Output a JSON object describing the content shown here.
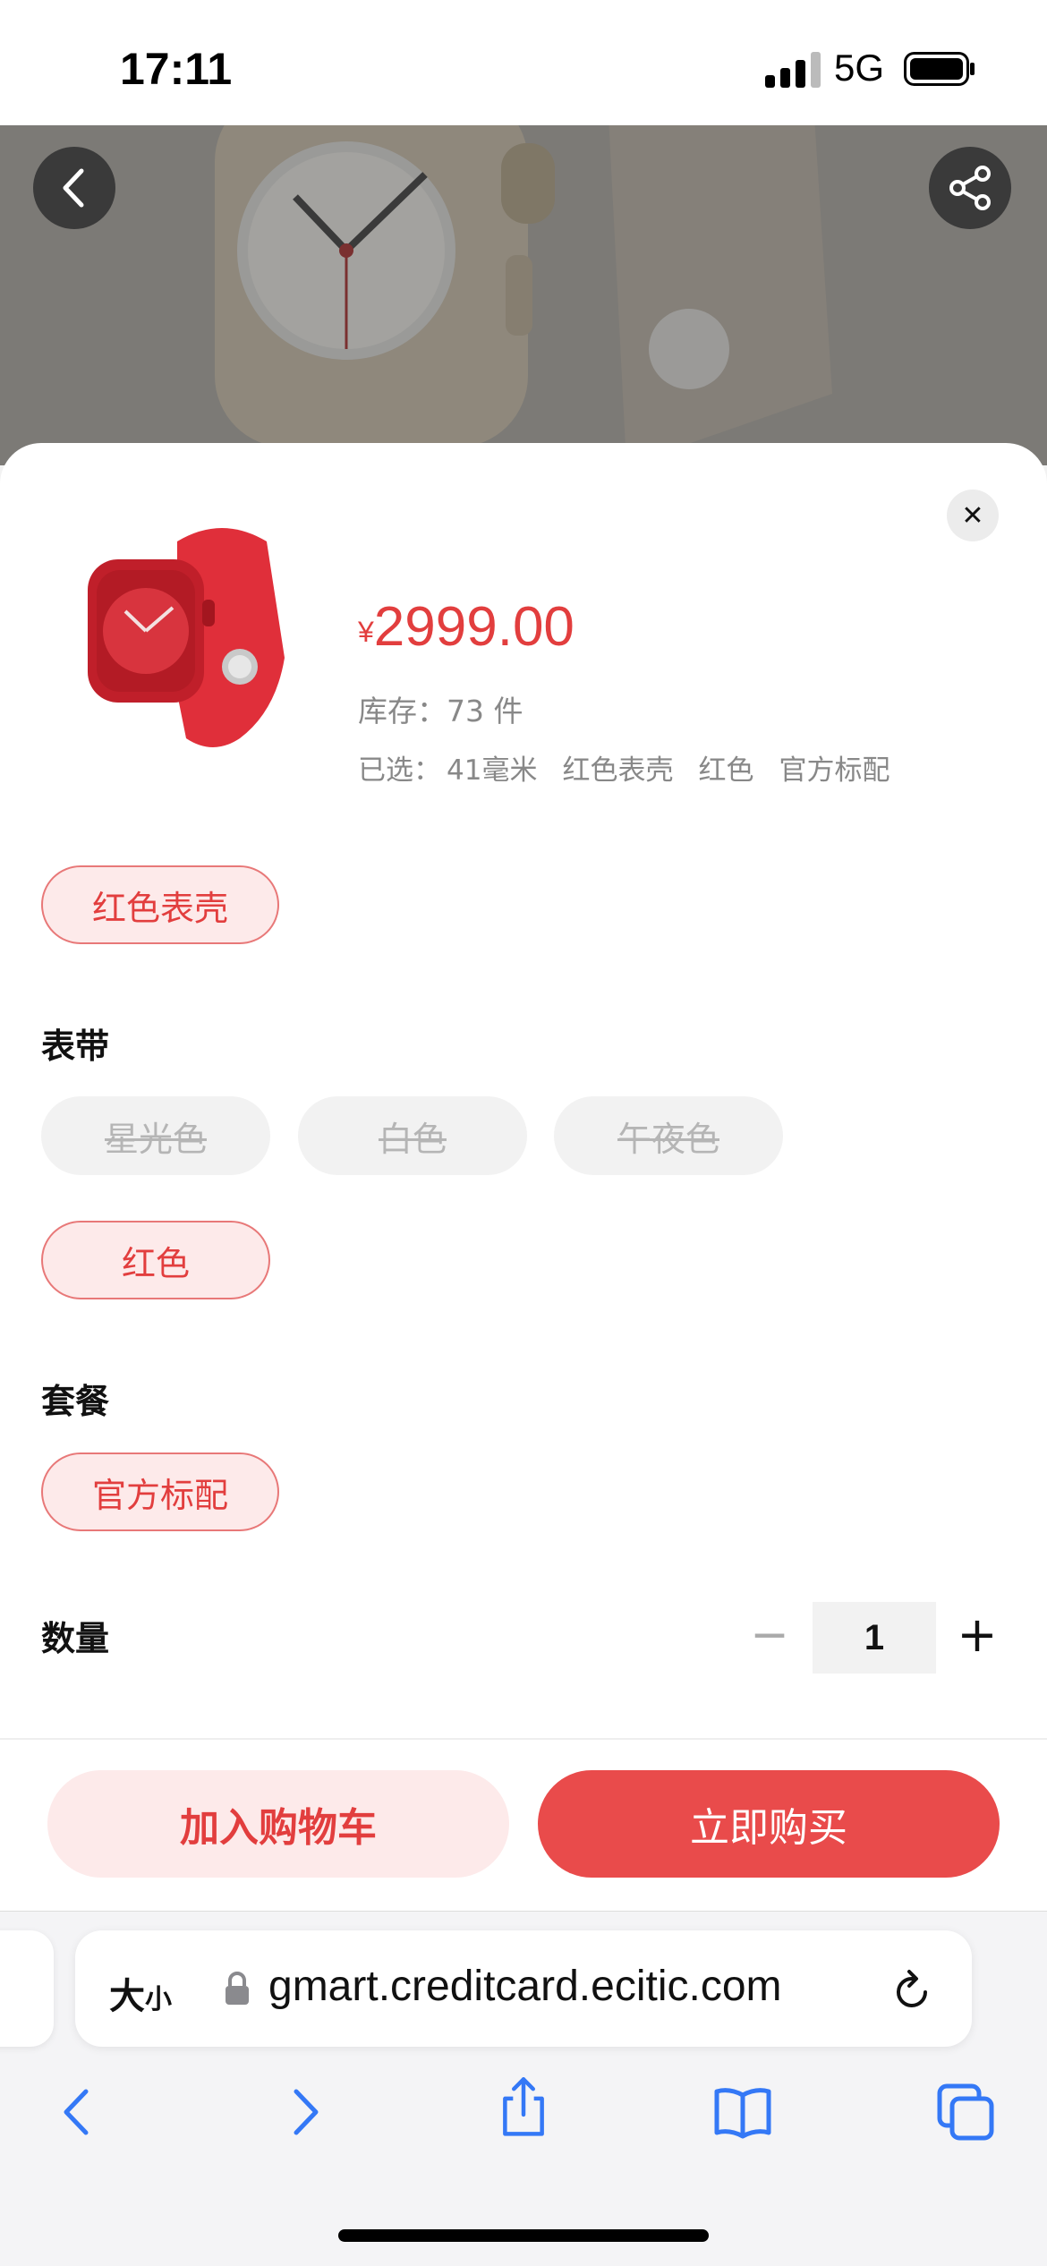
{
  "status_bar": {
    "time": "17:11",
    "network": "5G"
  },
  "product": {
    "currency": "¥",
    "price": "2999.00",
    "stock_label": "库存：73 件",
    "selected_label": "已选：",
    "selected_options": [
      "41毫米",
      "红色表壳",
      "红色",
      "官方标配"
    ]
  },
  "options": {
    "case": {
      "chips": [
        {
          "label": "红色表壳",
          "state": "active"
        }
      ]
    },
    "band": {
      "title": "表带",
      "chips": [
        {
          "label": "星光色",
          "state": "disabled"
        },
        {
          "label": "白色",
          "state": "disabled"
        },
        {
          "label": "午夜色",
          "state": "disabled"
        },
        {
          "label": "红色",
          "state": "active"
        }
      ]
    },
    "package": {
      "title": "套餐",
      "chips": [
        {
          "label": "官方标配",
          "state": "active"
        }
      ]
    }
  },
  "quantity": {
    "title": "数量",
    "value": "1",
    "minus": "−",
    "plus": "+"
  },
  "actions": {
    "add_to_cart": "加入购物车",
    "buy_now": "立即购买"
  },
  "close_glyph": "✕",
  "browser": {
    "text_size_label": "大",
    "text_size_small": "小",
    "url": "gmart.creditcard.ecitic.com"
  },
  "colors": {
    "accent": "#e23e3e",
    "buy_button": "#e94b4b",
    "chip_bg": "#fdeaea",
    "safari_blue": "#3478f6"
  }
}
